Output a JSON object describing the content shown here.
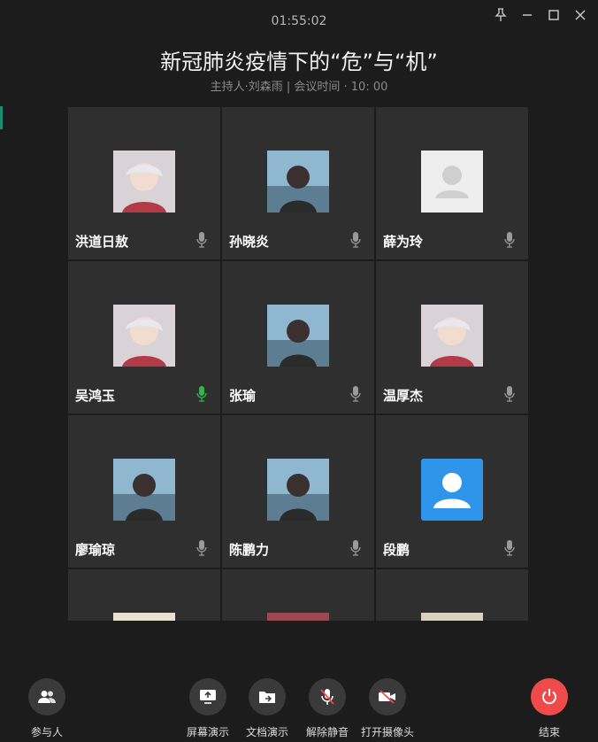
{
  "meeting": {
    "timer": "01:55:02",
    "title": "新冠肺炎疫情下的“危”与“机”",
    "subtitle": "主持人·刘森雨 | 会议时间 · 10: 00"
  },
  "window_controls": [
    "pin-icon",
    "minimize-icon",
    "maximize-icon",
    "close-icon"
  ],
  "participants": [
    {
      "name": "洪道日敖",
      "mic": "mic-icon",
      "avatar": "illustrated-avatar",
      "mic_active": false
    },
    {
      "name": "孙晓炎",
      "mic": "mic-icon",
      "avatar": "photo-avatar",
      "mic_active": false
    },
    {
      "name": "薛为玲",
      "mic": "mic-icon",
      "avatar": "default-avatar-gray",
      "mic_active": false
    },
    {
      "name": "吴鸿玉",
      "mic": "mic-icon",
      "avatar": "illustrated-avatar",
      "mic_active": true
    },
    {
      "name": "张瑜",
      "mic": "mic-icon",
      "avatar": "photo-avatar",
      "mic_active": false
    },
    {
      "name": "温厚杰",
      "mic": "mic-icon",
      "avatar": "illustrated-avatar",
      "mic_active": false
    },
    {
      "name": "廖瑜琼",
      "mic": "mic-icon",
      "avatar": "photo-avatar",
      "mic_active": false
    },
    {
      "name": "陈鹏力",
      "mic": "mic-icon",
      "avatar": "photo-avatar",
      "mic_active": false
    },
    {
      "name": "段鹏",
      "mic": "mic-icon",
      "avatar": "default-avatar-blue",
      "mic_active": false
    }
  ],
  "toolbar": {
    "participants_label": "参与人",
    "screen_share_label": "屏幕演示",
    "doc_share_label": "文档演示",
    "unmute_label": "解除静音",
    "camera_label": "打开摄像头",
    "end_label": "结束"
  },
  "colors": {
    "background": "#1c1c1c",
    "tile": "#2f2f2f",
    "mic_active": "#2fb84f",
    "end_button": "#f04b4b",
    "default_avatar_blue": "#2f95ea"
  }
}
